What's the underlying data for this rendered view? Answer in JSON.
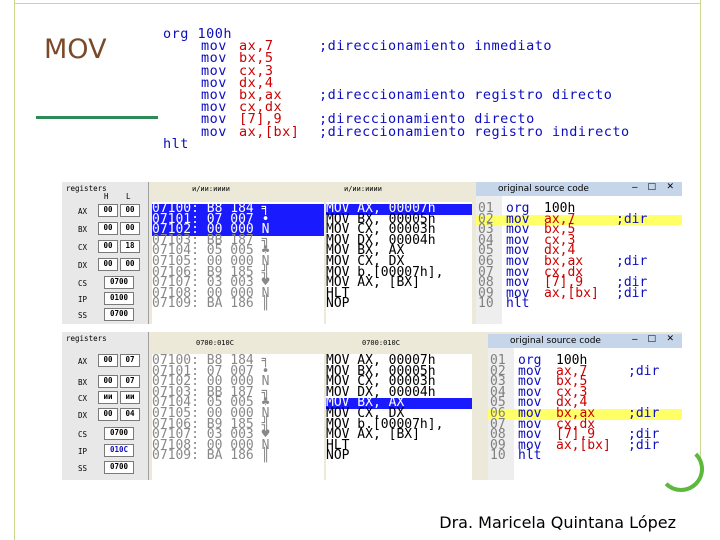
{
  "slide": {
    "title": "MOV",
    "author": "Dra. Maricela Quintana López"
  },
  "code": {
    "org": "org 100h",
    "lines": [
      {
        "m": "mov",
        "o": "ax,7",
        "c": ";direccionamiento inmediato"
      },
      {
        "m": "mov",
        "o": "bx,5",
        "c": ""
      },
      {
        "m": "mov",
        "o": "cx,3",
        "c": ""
      },
      {
        "m": "mov",
        "o": "dx,4",
        "c": ""
      },
      {
        "m": "mov",
        "o": "bx,ax",
        "c": ";direccionamiento registro directo"
      },
      {
        "m": "mov",
        "o": "cx,dx",
        "c": ""
      },
      {
        "m": "mov",
        "o": "[7],9",
        "c": ";direccionamiento directo"
      },
      {
        "m": "mov",
        "o": "ax,[bx]",
        "c": ";direccionamiento registro indirecto"
      }
    ],
    "end": "hlt"
  },
  "emu_top": {
    "registers_label": "registers",
    "hl": [
      "H",
      "L"
    ],
    "regs": [
      {
        "n": "AX",
        "h": "00",
        "l": "00"
      },
      {
        "n": "BX",
        "h": "00",
        "l": "00"
      },
      {
        "n": "CX",
        "h": "00",
        "l": "18"
      },
      {
        "n": "DX",
        "h": "00",
        "l": "00"
      }
    ],
    "seg": [
      {
        "n": "CS",
        "v": "0700"
      },
      {
        "n": "IP",
        "v": "0100"
      },
      {
        "n": "SS",
        "v": "0700"
      }
    ],
    "mem_hdr": "и/ии:ииии",
    "dis_hdr": "и/ии:ииии",
    "mem": [
      "07100: B8 184 ╕",
      "07101: 07 007 •",
      "07102: 00 000 N",
      "07103: BB 187 ╗",
      "07104: 05 005 ♣",
      "07105: 00 000 N",
      "07106: B9 185 ╣",
      "07107: 03 003 ♥",
      "07108: 00 000 N",
      "07109: BA 186 ║"
    ],
    "dis": [
      "MOV AX, 00007h",
      "MOV BX, 00005h",
      "MOV CX, 00003h",
      "MOV DX, 00004h",
      "MOV BX, AX",
      "MOV CX, DX",
      "MOV b.[00007h],",
      "MOV AX, [BX]",
      "HLT",
      "NOP"
    ],
    "src_title": "original source code",
    "src": [
      {
        "n": "01",
        "m": "org",
        "o": "100h",
        "c": ""
      },
      {
        "n": "02",
        "m": "mov",
        "o": "ax,7",
        "c": ";dir"
      },
      {
        "n": "03",
        "m": "mov",
        "o": "bx,5",
        "c": ""
      },
      {
        "n": "04",
        "m": "mov",
        "o": "cx,3",
        "c": ""
      },
      {
        "n": "05",
        "m": "mov",
        "o": "dx,4",
        "c": ""
      },
      {
        "n": "06",
        "m": "mov",
        "o": "bx,ax",
        "c": ";dir"
      },
      {
        "n": "07",
        "m": "mov",
        "o": "cx,dx",
        "c": ""
      },
      {
        "n": "08",
        "m": "mov",
        "o": "[7],9",
        "c": ";dir"
      },
      {
        "n": "09",
        "m": "mov",
        "o": "ax,[bx]",
        "c": ";dir"
      },
      {
        "n": "10",
        "m": "hlt",
        "o": "",
        "c": ""
      }
    ]
  },
  "emu_bottom": {
    "registers_label": "registers",
    "regs": [
      {
        "n": "AX",
        "h": "00",
        "l": "07"
      },
      {
        "n": "BX",
        "h": "00",
        "l": "07"
      },
      {
        "n": "CX",
        "h": "ии",
        "l": "ии"
      },
      {
        "n": "DX",
        "h": "00",
        "l": "04"
      }
    ],
    "seg": [
      {
        "n": "CS",
        "v": "0700"
      },
      {
        "n": "IP",
        "v": "010C"
      },
      {
        "n": "SS",
        "v": "0700"
      }
    ],
    "mem_hdr": "0700:010C",
    "dis_hdr": "0700:010C",
    "mem": [
      "07100: B8 184 ╕",
      "07101: 07 007 •",
      "07102: 00 000 N",
      "07103: BB 187 ╗",
      "07104: 05 005 ♣",
      "07105: 00 000 N",
      "07106: B9 185 ╣",
      "07107: 03 003 ♥",
      "07108: 00 000 N",
      "07109: BA 186 ║"
    ],
    "dis": [
      "MOV AX, 00007h",
      "MOV BX, 00005h",
      "MOV CX, 00003h",
      "MOV DX, 00004h",
      "MOV BX, AX",
      "MOV CX, DX",
      "MOV b.[00007h],",
      "MOV AX, [BX]",
      "HLT",
      "NOP"
    ],
    "src_title": "original source code",
    "src": [
      {
        "n": "01",
        "m": "org",
        "o": "100h",
        "c": ""
      },
      {
        "n": "02",
        "m": "mov",
        "o": "ax,7",
        "c": ";dir"
      },
      {
        "n": "03",
        "m": "mov",
        "o": "bx,5",
        "c": ""
      },
      {
        "n": "04",
        "m": "mov",
        "o": "cx,3",
        "c": ""
      },
      {
        "n": "05",
        "m": "mov",
        "o": "dx,4",
        "c": ""
      },
      {
        "n": "06",
        "m": "mov",
        "o": "bx,ax",
        "c": ";dir"
      },
      {
        "n": "07",
        "m": "mov",
        "o": "cx,dx",
        "c": ""
      },
      {
        "n": "08",
        "m": "mov",
        "o": "[7],9",
        "c": ";dir"
      },
      {
        "n": "09",
        "m": "mov",
        "o": "ax,[bx]",
        "c": ";dir"
      },
      {
        "n": "10",
        "m": "hlt",
        "o": "",
        "c": ""
      }
    ]
  }
}
